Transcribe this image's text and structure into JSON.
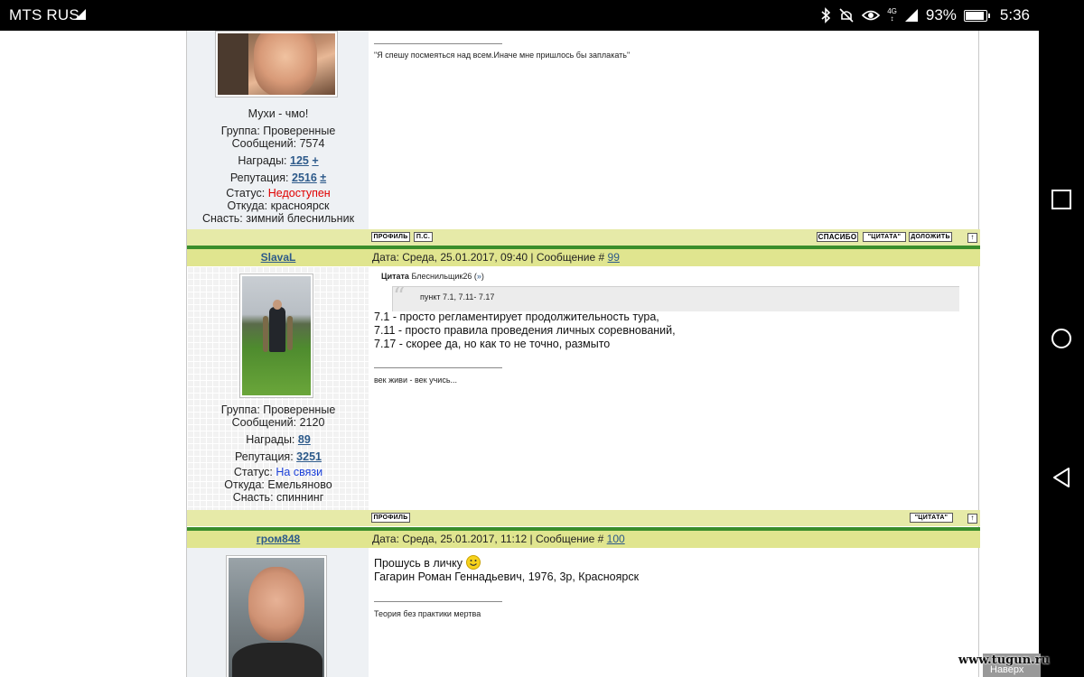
{
  "status_bar": {
    "carrier": "MTS RUS",
    "battery": "93%",
    "battery_level": 0.93,
    "time": "5:36",
    "network": "4G",
    "icons": [
      "bluetooth-icon",
      "mute-icon",
      "eye-icon",
      "signal-icon",
      "battery-icon"
    ]
  },
  "posts": [
    {
      "status_caption": "Мухи - чмо!",
      "group": "Группа: Проверенные",
      "messages": "Сообщений: 7574",
      "awards_label": "Награды:",
      "awards_value": "125",
      "awards_plus": "+",
      "reputation_label": "Репутация:",
      "reputation_value": "2516",
      "reputation_plus": "±",
      "status_label": "Статус:",
      "status_value": "Недоступен",
      "from": "Откуда: красноярск",
      "gear": "Снасть: зимний блеснильник",
      "signature": "\"Я спешу посмеяться над всем.Иначе мне пришлось бы заплакать\"",
      "buttons": {
        "profile": "ПРОФИЛЬ",
        "pm": "П.С.",
        "thanks": "СПАСИБО",
        "quote": "\"ЦИТАТА\"",
        "add": "ДОЛОЖИТЬ",
        "top": "↑"
      }
    },
    {
      "nick": "SlavaL",
      "date_text": "Дата: Среда, 25.01.2017, 09:40 | Сообщение #",
      "msg_num": "99",
      "quote_header": "Цитата",
      "quote_author": "Блеснильщик26",
      "quote_link": "»",
      "quote_text": "пункт 7.1,  7.11- 7.17",
      "lines": [
        "7.1 - просто регламентирует продолжительность тура,",
        "7.11 - просто правила проведения личных соревнований,",
        "7.17 - скорее да, но как то не точно, размыто"
      ],
      "signature": "век живи - век учись...",
      "group": "Группа: Проверенные",
      "messages": "Сообщений: 2120",
      "awards_label": "Награды:",
      "awards_value": "89",
      "reputation_label": "Репутация:",
      "reputation_value": "3251",
      "status_label": "Статус:",
      "status_value": "На связи",
      "from": "Откуда: Емельяново",
      "gear": "Снасть: спиннинг",
      "buttons": {
        "profile": "ПРОФИЛЬ",
        "quote": "\"ЦИТАТА\"",
        "top": "↑"
      }
    },
    {
      "nick": "гром848",
      "date_text": "Дата: Среда, 25.01.2017, 11:12 | Сообщение #",
      "msg_num": "100",
      "line1": "Прошусь в личку",
      "line2": "Гагарин Роман Геннадьевич, 1976, 3р, Красноярск",
      "signature": "Теория без практики мертва"
    }
  ],
  "watermark": {
    "site": "www.tugun.ru",
    "nav": "Наверх"
  }
}
